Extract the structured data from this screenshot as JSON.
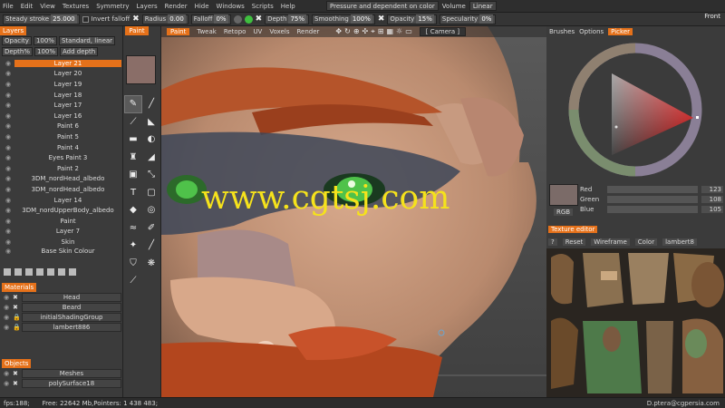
{
  "menu": {
    "items": [
      "File",
      "Edit",
      "View",
      "Textures",
      "Symmetry",
      "Layers",
      "Render",
      "Hide",
      "Windows",
      "Scripts",
      "Help"
    ],
    "pressure_mode": "Pressure and dependent on color",
    "volume_label": "Volume",
    "volume_mode": "Linear"
  },
  "toolbar": {
    "steady_label": "Steady stroke",
    "steady_value": "25.000",
    "invert_label": "Invert falloff",
    "radius_label": "Radius",
    "radius_value": "0.00",
    "falloff_label": "Falloff",
    "falloff_value": "0%",
    "depth_label": "Depth",
    "depth_value": "75%",
    "smoothing_label": "Smoothing",
    "smoothing_value": "100%",
    "opacity_label": "Opacity",
    "opacity_value": "15%",
    "specularity_label": "Specularity",
    "specularity_value": "0%",
    "colors": {
      "green": "#3fbf3f",
      "dark": "#666666"
    }
  },
  "layers_panel": {
    "title": "Layers",
    "opacity_label": "Opacity",
    "opacity_value": "100%",
    "blend_mode": "Standard, linear",
    "depth_label": "Depth%",
    "depth_value": "100%",
    "depth_mode": "Add depth",
    "items": [
      {
        "name": "Layer 21",
        "active": true
      },
      {
        "name": "Layer 20"
      },
      {
        "name": "Layer 19"
      },
      {
        "name": "Layer 18"
      },
      {
        "name": "Layer 17"
      },
      {
        "name": "Layer 16"
      },
      {
        "name": "Paint 6"
      },
      {
        "name": "Paint 5"
      },
      {
        "name": "Paint 4"
      },
      {
        "name": "Eyes Paint 3"
      },
      {
        "name": "Paint 2"
      },
      {
        "name": "3DM_nordHead_albedo"
      },
      {
        "name": "3DM_nordHead_albedo"
      },
      {
        "name": "Layer 14"
      },
      {
        "name": "3DM_nordUpperBody_albedo"
      },
      {
        "name": "Paint"
      },
      {
        "name": "Layer 7"
      },
      {
        "name": "Skin"
      },
      {
        "name": "Base Skin Colour"
      }
    ]
  },
  "materials_panel": {
    "title": "Materials",
    "items": [
      "Head",
      "Beard",
      "initialShadingGroup",
      "lambert886"
    ]
  },
  "objects_panel": {
    "title": "Objects",
    "items": [
      "Meshes",
      "polySurface18"
    ]
  },
  "tools": {
    "paint_tab": "Paint",
    "swatch_color": "#8a6e68"
  },
  "viewport": {
    "tabs": [
      "Paint",
      "Tweak",
      "Retopo",
      "UV",
      "Voxels",
      "Render"
    ],
    "camera_label": "[ Camera ]",
    "view_label": "Front",
    "watermark": "www.cgtsj.com"
  },
  "right_panel": {
    "tabs": [
      "Brushes",
      "Options",
      "Picker"
    ],
    "red_label": "Red",
    "red_value": "123",
    "green_label": "Green",
    "green_value": "108",
    "blue_label": "Blue",
    "blue_value": "105",
    "rgb_label": "RGB",
    "picked_color": "#7b6b68"
  },
  "texture_editor": {
    "title": "Texture editor",
    "help": "?",
    "reset": "Reset",
    "wireframe": "Wireframe",
    "color": "Color",
    "material": "lambert8"
  },
  "status": {
    "fps": "fps:188;",
    "free": "Free: 22642 Mb,Pointers: 1 438 483;",
    "credit": "D.ptera@cgpersia.com"
  }
}
